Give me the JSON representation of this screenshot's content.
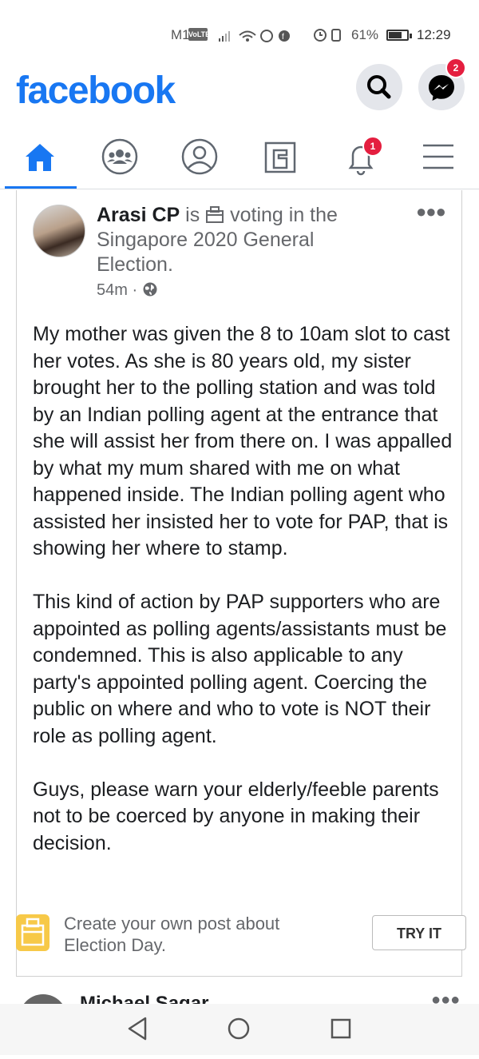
{
  "status_bar": {
    "carrier": "M1",
    "volte": "VoLTE",
    "battery": "61%",
    "time": "12:29"
  },
  "header": {
    "logo": "facebook",
    "messenger_badge": "2",
    "icons": [
      "search-icon",
      "messenger-icon"
    ]
  },
  "tabs": [
    {
      "name": "home",
      "icon": "home-icon",
      "active": true
    },
    {
      "name": "groups",
      "icon": "groups-icon"
    },
    {
      "name": "profile",
      "icon": "profile-icon"
    },
    {
      "name": "pages",
      "icon": "pages-icon"
    },
    {
      "name": "notifications",
      "icon": "bell-icon",
      "badge": "1"
    },
    {
      "name": "menu",
      "icon": "menu-icon"
    }
  ],
  "post": {
    "author": "Arasi CP",
    "activity_prefix": " is ",
    "activity": "voting in the Singapore 2020 General Election.",
    "time": "54m",
    "privacy_icon": "globe-icon",
    "text": "My mother was given the 8 to 10am slot to cast her votes. As she is 80 years old, my sister brought her to the polling station and was told by an Indian polling agent at the entrance that she will assist her from there on.  I was appalled by what my mum shared with me on what happened inside.  The Indian polling agent who assisted her insisted her to vote for PAP, that is showing her where to stamp.\n\nThis kind of action by PAP supporters who are appointed as polling agents/assistants must be condemned. This is also applicable to any party's appointed polling agent. Coercing the public on where and who to vote is NOT their role as polling agent.\n\nGuys,  please warn your elderly/feeble parents not to be coerced by anyone in making their decision."
  },
  "cta": {
    "text": "Create your own post about\nElection Day.",
    "button": "TRY IT"
  },
  "next_post": {
    "author": "Michael Sagar"
  },
  "colors": {
    "brand": "#1877f2",
    "badge": "#e41e3f"
  }
}
